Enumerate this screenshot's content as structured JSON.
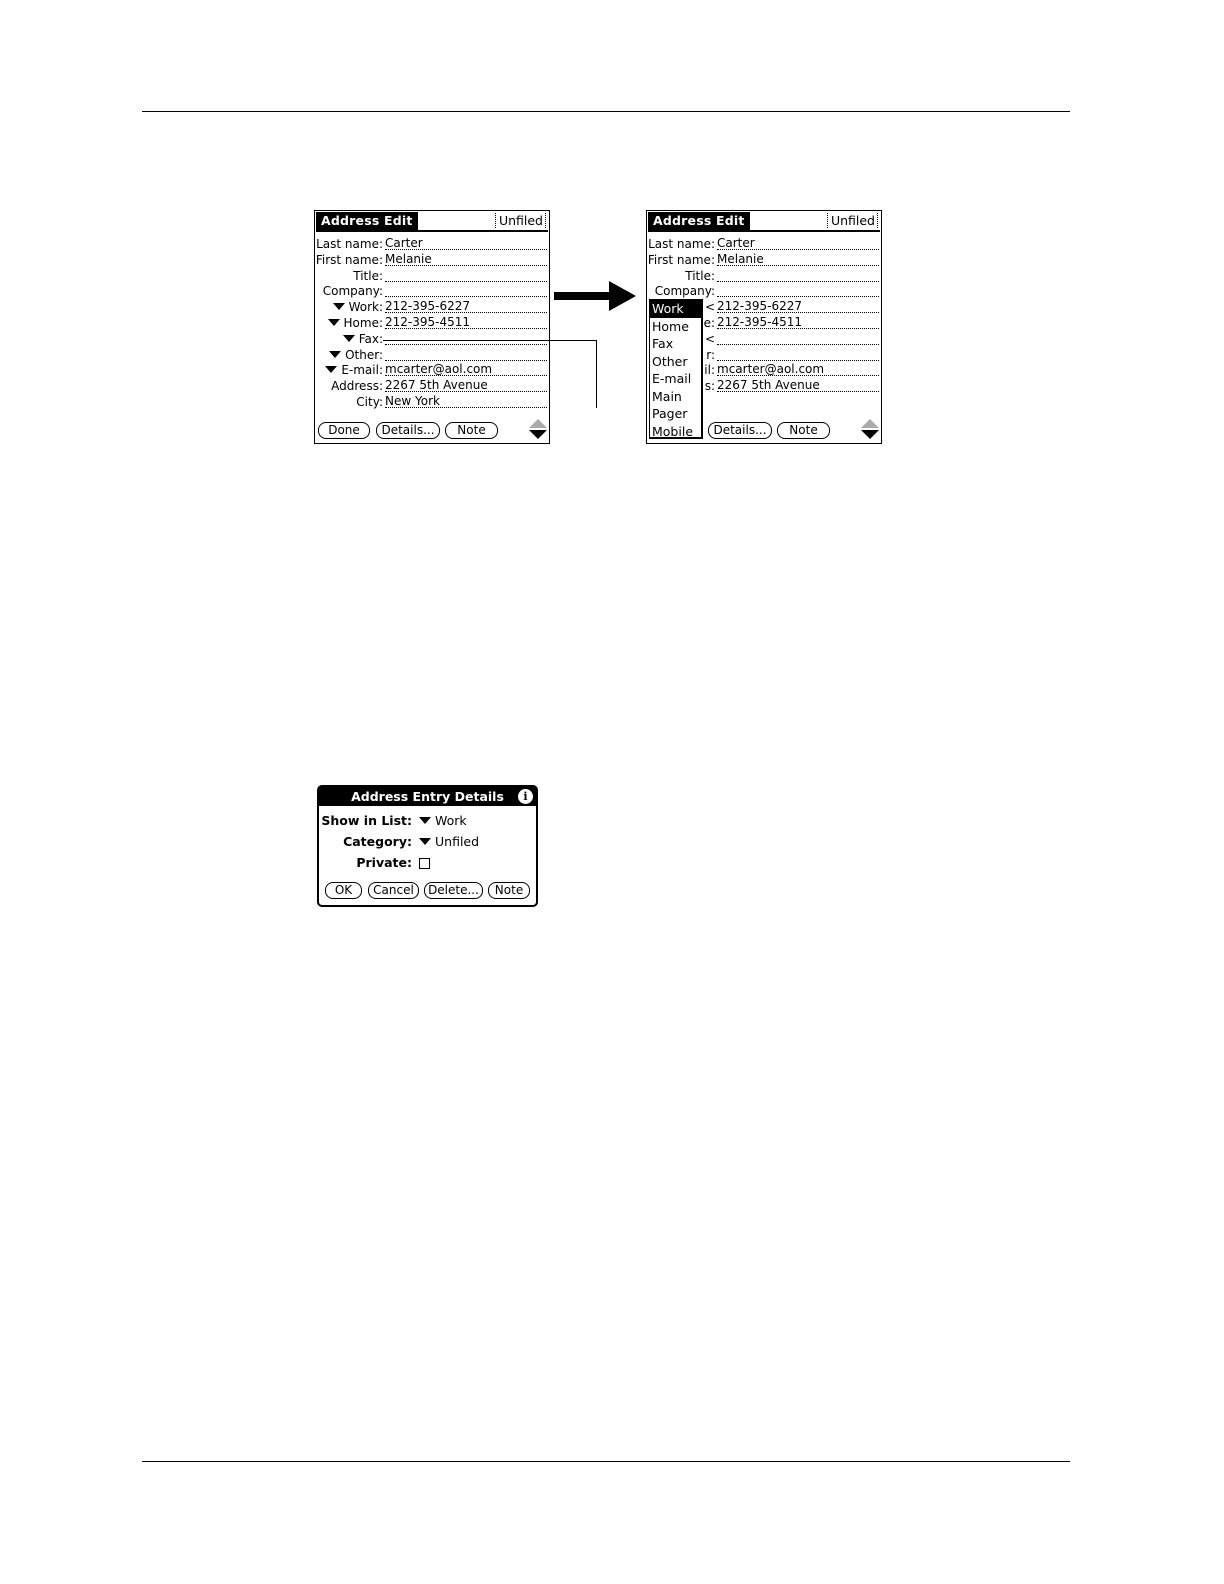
{
  "screen1": {
    "title": "Address Edit",
    "category": "Unfiled",
    "fields": [
      {
        "label": "Last name:",
        "value": "Carter",
        "dropdown": false
      },
      {
        "label": "First name:",
        "value": "Melanie",
        "dropdown": false
      },
      {
        "label": "Title:",
        "value": "",
        "dropdown": false
      },
      {
        "label": "Company:",
        "value": "",
        "dropdown": false
      },
      {
        "label": "Work:",
        "value": "212-395-6227",
        "dropdown": true
      },
      {
        "label": "Home:",
        "value": "212-395-4511",
        "dropdown": true
      },
      {
        "label": "Fax:",
        "value": "",
        "dropdown": true
      },
      {
        "label": "Other:",
        "value": "",
        "dropdown": true
      },
      {
        "label": "E-mail:",
        "value": "mcarter@aol.com",
        "dropdown": true
      },
      {
        "label": "Address:",
        "value": "2267 5th Avenue",
        "dropdown": false
      },
      {
        "label": "City:",
        "value": "New York",
        "dropdown": false
      }
    ],
    "buttons": {
      "done": "Done",
      "details": "Details...",
      "note": "Note"
    }
  },
  "screen2": {
    "title": "Address Edit",
    "category": "Unfiled",
    "fields": [
      {
        "label": "Last name:",
        "value": "Carter"
      },
      {
        "label": "First name:",
        "value": "Melanie"
      },
      {
        "label": "Title:",
        "value": ""
      },
      {
        "label": "Company:",
        "value": ""
      },
      {
        "label": "<",
        "value": "212-395-6227"
      },
      {
        "label": "e:",
        "value": "212-395-4511"
      },
      {
        "label": "<",
        "value": ""
      },
      {
        "label": "r:",
        "value": ""
      },
      {
        "label": "il:",
        "value": "mcarter@aol.com"
      },
      {
        "label": "s:",
        "value": "2267 5th Avenue"
      }
    ],
    "popup_items": [
      "Work",
      "Home",
      "Fax",
      "Other",
      "E-mail",
      "Main",
      "Pager",
      "Mobile"
    ],
    "popup_selected": "Work",
    "buttons": {
      "details": "Details...",
      "note": "Note"
    }
  },
  "details_dialog": {
    "title": "Address Entry Details",
    "show_in_list_label": "Show in List:",
    "show_in_list_value": "Work",
    "category_label": "Category:",
    "category_value": "Unfiled",
    "private_label": "Private:",
    "private_checked": false,
    "buttons": {
      "ok": "OK",
      "cancel": "Cancel",
      "delete": "Delete...",
      "note": "Note"
    }
  }
}
